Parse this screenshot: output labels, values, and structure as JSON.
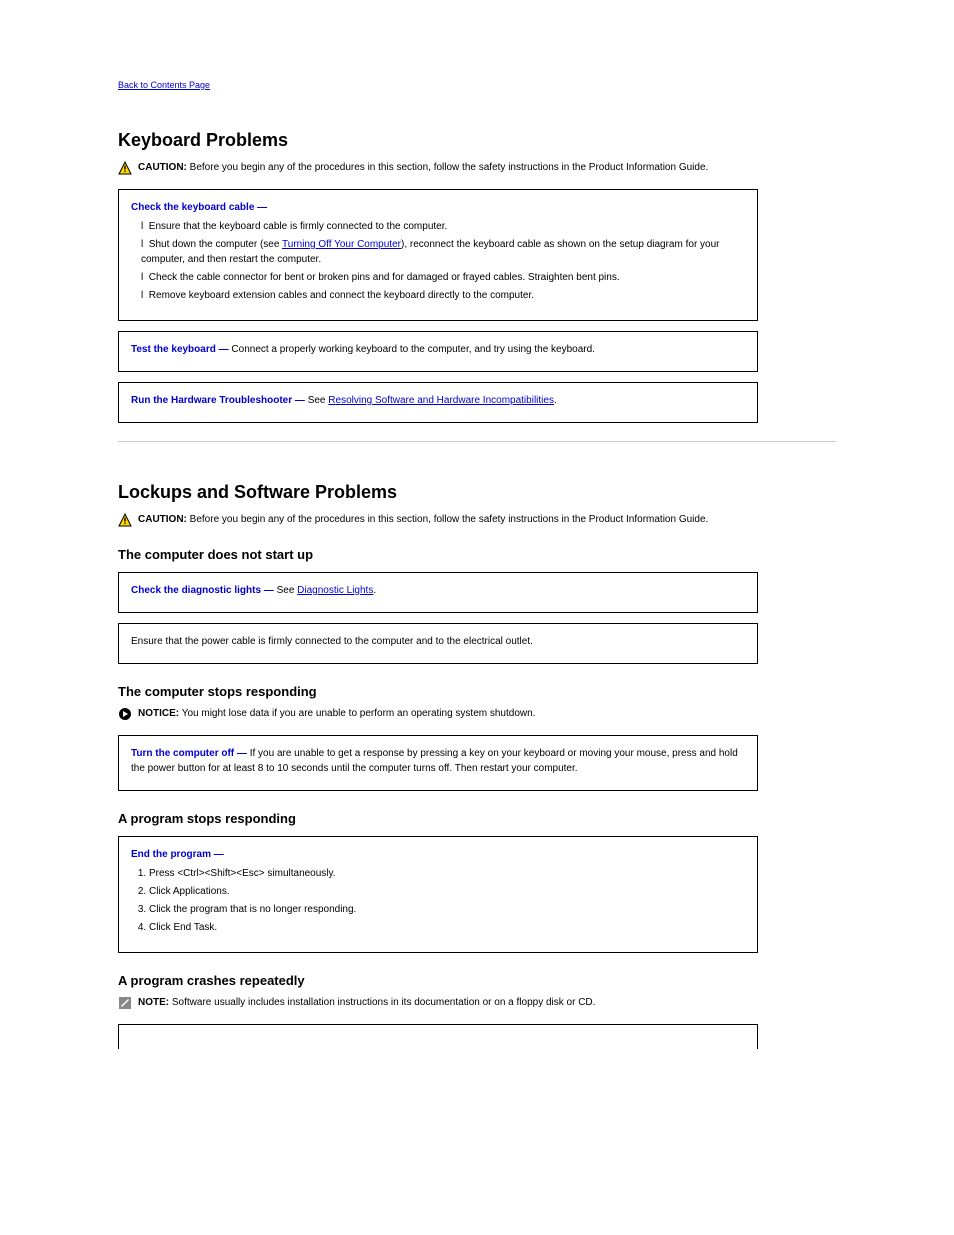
{
  "top": {
    "back": "Back to Contents Page"
  },
  "keyboard": {
    "title": "Keyboard Problems",
    "caution_label": "CAUTION:",
    "caution_text": "Before you begin any of the procedures in this section, follow the safety instructions in the Product Information Guide.",
    "box1": {
      "lead": "Check the keyboard cable —",
      "items": [
        "Ensure that the keyboard cable is firmly connected to the computer.",
        {
          "pre": "Shut down the computer (see ",
          "link": "Turning Off Your Computer",
          "post": "), reconnect the keyboard cable as shown on the setup diagram for your computer, and then restart the computer."
        },
        "Check the cable connector for bent or broken pins and for damaged or frayed cables. Straighten bent pins.",
        "Remove keyboard extension cables and connect the keyboard directly to the computer."
      ]
    },
    "box2": {
      "lead": "Test the keyboard —",
      "text": "Connect a properly working keyboard to the computer, and try using the keyboard."
    },
    "box3": {
      "lead": "Run the Hardware Troubleshooter —",
      "see": "See ",
      "link": "Resolving Software and Hardware Incompatibilities",
      "period": "."
    }
  },
  "lockups": {
    "title": "Lockups and Software Problems",
    "caution_label": "CAUTION:",
    "caution_text": "Before you begin any of the procedures in this section, follow the safety instructions in the Product Information Guide.",
    "sub1": "The computer does not start up",
    "box_diag": {
      "lead": "Check the diagnostic lights —",
      "see": "See ",
      "link": "Diagnostic Lights",
      "period": "."
    },
    "box_cable": {
      "text": "Ensure that the power cable is firmly connected to the computer and to the electrical outlet."
    },
    "sub2": "The computer stops responding",
    "notice_label": "NOTICE:",
    "notice_text": "You might lose data if you are unable to perform an operating system shutdown.",
    "box_off": {
      "lead": "Turn the computer off —",
      "text": "If you are unable to get a response by pressing a key on your keyboard or moving your mouse, press and hold the power button for at least 8 to 10 seconds until the computer turns off. Then restart your computer."
    },
    "sub3": "A program stops responding",
    "box_end": {
      "lead": "End the program —",
      "items": [
        "Press <Ctrl><Shift><Esc> simultaneously.",
        "Click Applications.",
        "Click the program that is no longer responding.",
        "Click End Task."
      ]
    },
    "sub4": "A program crashes repeatedly",
    "note_label": "NOTE:",
    "note_text": "Software usually includes installation instructions in its documentation or on a floppy disk or CD."
  }
}
